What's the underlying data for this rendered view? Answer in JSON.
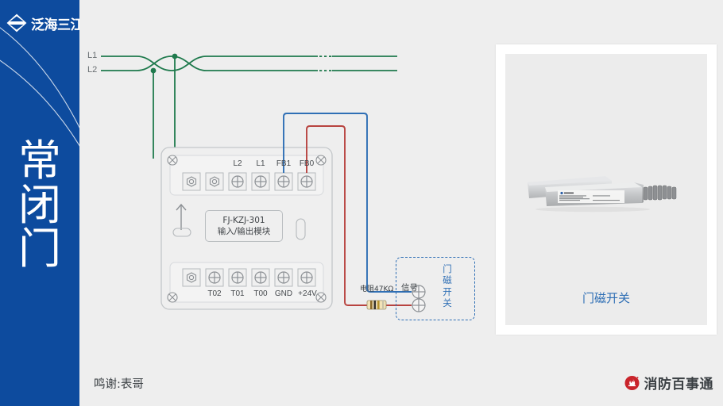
{
  "sidebar": {
    "brand_logo_name": "fanhai-sanjiang-logo-icon",
    "brand_name": "泛海三江",
    "title_chars": [
      "常",
      "闭",
      "门"
    ],
    "bg_color": "#0d4b9e"
  },
  "diagram": {
    "bus_lines": [
      {
        "name": "L1",
        "label": "L1",
        "color": "#1f7a4d"
      },
      {
        "name": "L2",
        "label": "L2",
        "color": "#1f7a4d"
      }
    ],
    "module": {
      "model": "FJ-KZJ-301",
      "type_label": "输入/输出模块",
      "top_terminals": [
        "",
        "",
        "L2",
        "L1",
        "FB1",
        "FB0"
      ],
      "bottom_terminals": [
        "",
        "T02",
        "T01",
        "T00",
        "GND",
        "+24V"
      ],
      "arrow_icon": "up-arrow-icon"
    },
    "wires": {
      "bus_color": "#1f7a4d",
      "fb1_color": "#2f6fb5",
      "fb0_color": "#b8433f"
    },
    "resistor": {
      "label": "电阻47KΩ"
    },
    "door_switch": {
      "box_title_chars": [
        "门",
        "磁",
        "开",
        "关"
      ],
      "signal_label": "信号",
      "terminal_count": 2,
      "border_color": "#2f6fb5"
    }
  },
  "product_card": {
    "caption": "门磁开关",
    "photo_name": "door-magnetic-switch-photo"
  },
  "footer": {
    "credit": "鸣谢:表哥",
    "brand_text": "消防百事通",
    "brand_logo_name": "xiaofang-baishitong-logo-icon",
    "brand_color": "#c9242b"
  }
}
